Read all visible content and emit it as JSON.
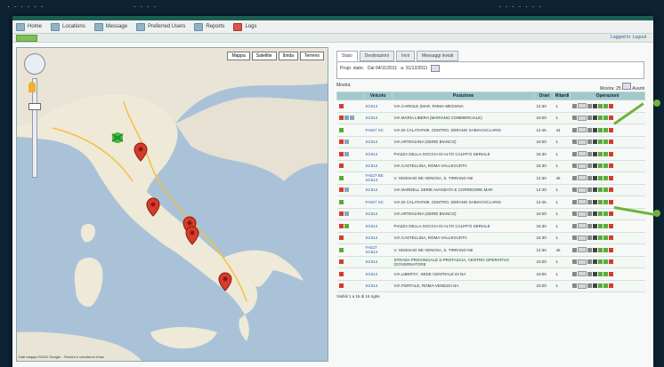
{
  "toolbar": {
    "items": [
      {
        "label": "Home",
        "icon": "home-icon"
      },
      {
        "label": "Locations",
        "icon": "map-icon"
      },
      {
        "label": "Message",
        "icon": "envelope-icon"
      },
      {
        "label": "Preferred Users",
        "icon": "users-icon"
      },
      {
        "label": "Reports",
        "icon": "report-icon"
      },
      {
        "label": "Logs",
        "icon": "log-icon"
      }
    ],
    "logout_label": "Logged in: Logout"
  },
  "map": {
    "type_buttons": [
      "Mappa",
      "Satellite",
      "Ibrida",
      "Terreno"
    ],
    "footer": "Dati mappa ©2011 Google - Termini e condizioni d'uso"
  },
  "panel": {
    "tabs": [
      "Stato",
      "Destinazioni",
      "Invii",
      "Messaggi inviati"
    ],
    "filter_label": "Propr. stato:",
    "filter_from": "Dal 04/11/2011",
    "filter_to": "a: 31/12/2011",
    "show_label": "Mostra:",
    "records_label": "Mostra: 25",
    "next_label": "Avanti",
    "columns": [
      "",
      "Veicolo",
      "Posizione",
      "Orari",
      "Ritardi",
      "Operazioni"
    ],
    "rows": [
      {
        "icons": [
          "r"
        ],
        "vehicle": "SC614",
        "position": "VIA CARDILE (MAR, ROMA-MESSINA",
        "time": "14:30",
        "delay": "1"
      },
      {
        "icons": [
          "r",
          "b",
          "b"
        ],
        "vehicle": "SC614",
        "position": "VIA MARIA LIBERA (MARIANO COMMERCIALE)",
        "time": "15:00",
        "delay": "1"
      },
      {
        "icons": [
          "g"
        ],
        "vehicle": "FA527 SC",
        "position": "VIA DI CALATAFIMI, CENTRO, SERANO SABIAYA/CLARIS",
        "time": "14:45",
        "delay": "44"
      },
      {
        "icons": [
          "r",
          "b"
        ],
        "vehicle": "SC614",
        "position": "VIA ARTEGIANA (SERIE BIANCO)",
        "time": "16:00",
        "delay": "1"
      },
      {
        "icons": [
          "r",
          "b"
        ],
        "vehicle": "SC614",
        "position": "PIAZZA DELLA GOCCIA DI ALTO CALIFFO SERIALE",
        "time": "15:30",
        "delay": "1"
      },
      {
        "icons": [
          "r"
        ],
        "vehicle": "SC614",
        "position": "VIA CASTELLINA, ROMA-VALLEVUOTA",
        "time": "15:30",
        "delay": "1"
      },
      {
        "icons": [
          "g"
        ],
        "vehicle": "FA527 BE SC614",
        "position": "V. GENNAIO DE VENOSA, S. TIRRANO NE",
        "time": "14:30",
        "delay": "46"
      },
      {
        "icons": [
          "r",
          "b"
        ],
        "vehicle": "SC614",
        "position": "VIA NARDELL SERIE AVANZATA E CORRIDORE MAR",
        "time": "14:40",
        "delay": "1"
      },
      {
        "icons": [
          "g"
        ],
        "vehicle": "FA527 SC",
        "position": "VIA DI CALATAFIMI, CENTRO, SERANO SABIAYA/CLARIS",
        "time": "14:45",
        "delay": "1"
      },
      {
        "icons": [
          "r",
          "b"
        ],
        "vehicle": "SC614",
        "position": "VIA ARTEGIANA (SERIE BIANCO)",
        "time": "16:00",
        "delay": "1"
      },
      {
        "icons": [
          "r",
          "g"
        ],
        "vehicle": "SC614",
        "position": "PIAZZA DELLA GOCCIA DI ALTO CALIFFO SERIALE",
        "time": "15:30",
        "delay": "1"
      },
      {
        "icons": [
          "r"
        ],
        "vehicle": "SC614",
        "position": "VIA CASTELLINA, ROMA-VALLEVUOTA",
        "time": "15:30",
        "delay": "1"
      },
      {
        "icons": [
          "g"
        ],
        "vehicle": "FA527 SC614",
        "position": "V. GENNAIO DE VENOSA, S. TIRRANO NE",
        "time": "14:30",
        "delay": "46"
      },
      {
        "icons": [
          "r"
        ],
        "vehicle": "SC614",
        "position": "STRADA PROVINCIALE S.PROTASCIA, CENTRO OPERATIVO (GOVERNATORE",
        "time": "15:00",
        "delay": "1"
      },
      {
        "icons": [
          "r"
        ],
        "vehicle": "SC614",
        "position": "VIA LIBERTA', SEDE CENTRALE DI NA",
        "time": "15:00",
        "delay": "1"
      },
      {
        "icons": [
          "r"
        ],
        "vehicle": "SC614",
        "position": "VIA PORTALE, ROMA-VENEZIA NA",
        "time": "15:00",
        "delay": "1"
      }
    ],
    "pager": "Visibili 1 a 16 di 16 righe"
  },
  "colors": {
    "header": "#1b5f54",
    "accent_green": "#6fb23a",
    "pin_red": "#d43c2c"
  }
}
